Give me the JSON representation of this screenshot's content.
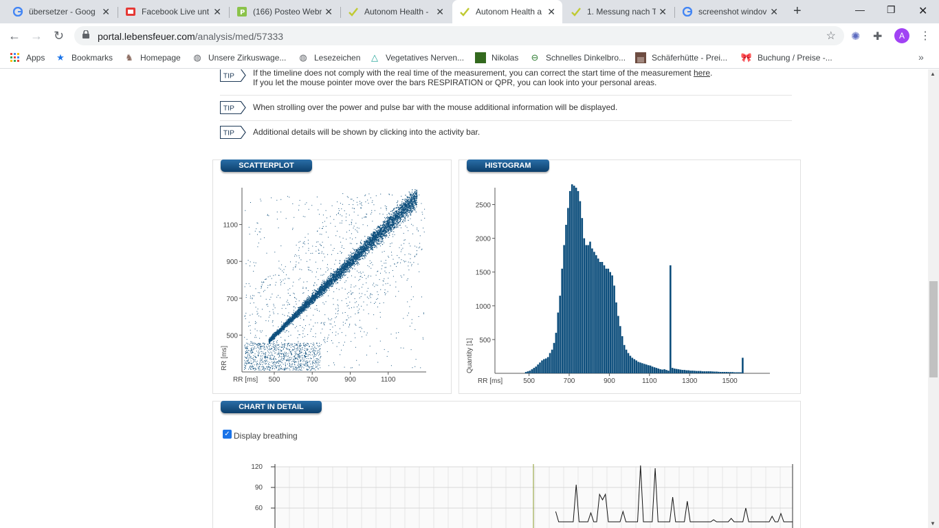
{
  "browser": {
    "tabs": [
      {
        "title": "übersetzer - Goog",
        "icon": "google-icon"
      },
      {
        "title": "Facebook Live unt",
        "icon": "facebook-live-icon"
      },
      {
        "title": "(166) Posteo Webr",
        "icon": "posteo-icon"
      },
      {
        "title": "Autonom Health -",
        "icon": "autonom-health-icon"
      },
      {
        "title": "Autonom Health a",
        "icon": "autonom-health-icon",
        "active": true
      },
      {
        "title": "1. Messung nach T",
        "icon": "autonom-health-icon"
      },
      {
        "title": "screenshot windov",
        "icon": "google-icon"
      }
    ],
    "url_host": "portal.lebensfeuer.com",
    "url_path": "/analysis/med/57333",
    "profile_initial": "A",
    "bookmarks": [
      "Apps",
      "Bookmarks",
      "Homepage",
      "Unsere Zirkuswage...",
      "Lesezeichen",
      "Vegetatives Nerven...",
      "Nikolas",
      "Schnelles Dinkelbro...",
      "Schäferhütte - Prei...",
      "Buchung / Preise -..."
    ]
  },
  "tips": [
    {
      "badge": "TIP",
      "line1_pre": "If the timeline does not comply with the real time of the measurement, you can correct the start time of the measurement ",
      "line1_link": "here",
      "line1_post": ".",
      "line2": "If you let the mouse pointer move over the bars RESPIRATION or QPR, you can look into your personal areas."
    },
    {
      "badge": "TIP",
      "text": "When strolling over the power and pulse bar with the mouse additional information will be displayed."
    },
    {
      "badge": "TIP",
      "text": "Additional details will be shown by clicking into the activity bar."
    }
  ],
  "panels": {
    "scatter_title": "SCATTERPLOT",
    "histogram_title": "HISTOGRAM",
    "detail_title": "CHART IN DETAIL",
    "display_breathing_label": "Display breathing",
    "display_breathing_checked": true
  },
  "colors": {
    "accent": "#0d4e7c",
    "panel_title": "#0c3f6b"
  },
  "chart_data": [
    {
      "type": "scatter",
      "title": "SCATTERPLOT",
      "xlabel": "RR [ms]",
      "ylabel": "RR [ms]",
      "xticks": [
        500,
        700,
        900,
        1100
      ],
      "yticks": [
        500,
        700,
        900,
        1100
      ],
      "xlim": [
        330,
        1300
      ],
      "ylim": [
        300,
        1300
      ],
      "description_points": "dense diagonal cluster from ~470 to ~1200 ms (x≈y), with scattered points around"
    },
    {
      "type": "bar",
      "title": "HISTOGRAM",
      "xlabel": "RR [ms]",
      "ylabel": "Quantity [1]",
      "xticks": [
        500,
        700,
        900,
        1100,
        1300,
        1500
      ],
      "yticks": [
        500,
        1000,
        1500,
        2000,
        2500
      ],
      "ylim": [
        0,
        2750
      ],
      "bin_width_ms": 10,
      "x": [
        480,
        490,
        500,
        510,
        520,
        530,
        540,
        550,
        560,
        570,
        580,
        590,
        600,
        610,
        620,
        630,
        640,
        650,
        660,
        670,
        680,
        690,
        700,
        710,
        720,
        730,
        740,
        750,
        760,
        770,
        780,
        790,
        800,
        810,
        820,
        830,
        840,
        850,
        860,
        870,
        880,
        890,
        900,
        910,
        920,
        930,
        940,
        950,
        960,
        970,
        980,
        990,
        1000,
        1010,
        1020,
        1030,
        1040,
        1050,
        1060,
        1070,
        1080,
        1090,
        1100,
        1110,
        1120,
        1130,
        1140,
        1150,
        1160,
        1170,
        1180,
        1190,
        1200,
        1210,
        1220,
        1230,
        1240,
        1250,
        1260,
        1270,
        1280,
        1290,
        1300,
        1310,
        1320,
        1330,
        1340,
        1350,
        1360,
        1370,
        1380,
        1390,
        1400,
        1410,
        1420,
        1430,
        1440,
        1450,
        1460,
        1470,
        1480,
        1490,
        1500,
        1510,
        1520,
        1530,
        1540,
        1550,
        1560,
        1570,
        1580,
        1590,
        1600,
        1610,
        1620,
        1630
      ],
      "values": [
        20,
        30,
        40,
        60,
        80,
        100,
        130,
        160,
        190,
        210,
        220,
        240,
        300,
        350,
        450,
        600,
        900,
        1150,
        1550,
        1900,
        2200,
        2450,
        2700,
        2800,
        2780,
        2750,
        2700,
        2550,
        2300,
        2000,
        1900,
        1900,
        1950,
        1850,
        1800,
        1750,
        1700,
        1650,
        1650,
        1600,
        1550,
        1550,
        1500,
        1450,
        1300,
        1050,
        850,
        700,
        550,
        420,
        350,
        300,
        260,
        230,
        210,
        190,
        170,
        160,
        150,
        140,
        130,
        120,
        115,
        100,
        90,
        80,
        70,
        60,
        55,
        60,
        50,
        40,
        1600,
        80,
        70,
        65,
        60,
        55,
        50,
        50,
        45,
        45,
        40,
        40,
        38,
        35,
        35,
        35,
        30,
        30,
        30,
        30,
        30,
        28,
        25,
        25,
        22,
        20,
        20,
        20,
        20,
        18,
        18,
        18,
        15,
        15,
        15,
        15,
        230,
        0
      ]
    },
    {
      "type": "line",
      "title": "CHART IN DETAIL",
      "yticks": [
        60,
        90,
        120
      ],
      "ylim": [
        40,
        130
      ],
      "series": [
        {
          "values": [
            0,
            0,
            0,
            0,
            0,
            0,
            0,
            0,
            0,
            0,
            0,
            0,
            0,
            0,
            0,
            0,
            0,
            0,
            0,
            0,
            0,
            0,
            0,
            0,
            0,
            0,
            0,
            0,
            0,
            0,
            0,
            0,
            0,
            0,
            0,
            0,
            0,
            0,
            0,
            0,
            0,
            0,
            0,
            0,
            0,
            0,
            0,
            0,
            0,
            0,
            0,
            0,
            0,
            0,
            0,
            0,
            0,
            0,
            0,
            0,
            0,
            0,
            0,
            0,
            0,
            0,
            0,
            0,
            0,
            0,
            0,
            0,
            0,
            0,
            0,
            0,
            0,
            0,
            0,
            0,
            0,
            0,
            0,
            0,
            0,
            0,
            0,
            0,
            0,
            0,
            0,
            0,
            0,
            0,
            0,
            0,
            55,
            40,
            40,
            40,
            40,
            40,
            40,
            94,
            40,
            40,
            40,
            40,
            53,
            40,
            40,
            80,
            72,
            80,
            40,
            40,
            40,
            40,
            40,
            55,
            40,
            40,
            40,
            40,
            40,
            122,
            40,
            40,
            40,
            40,
            118,
            40,
            40,
            40,
            40,
            40,
            76,
            40,
            40,
            40,
            40,
            70,
            40,
            40,
            40,
            40,
            40,
            40,
            40,
            40,
            43,
            40,
            40,
            40,
            40,
            40,
            45,
            40,
            40,
            40,
            40,
            60,
            40,
            40,
            40,
            40,
            40,
            40,
            40,
            40,
            48,
            40,
            40,
            52,
            40,
            40,
            40,
            40
          ]
        }
      ]
    }
  ]
}
